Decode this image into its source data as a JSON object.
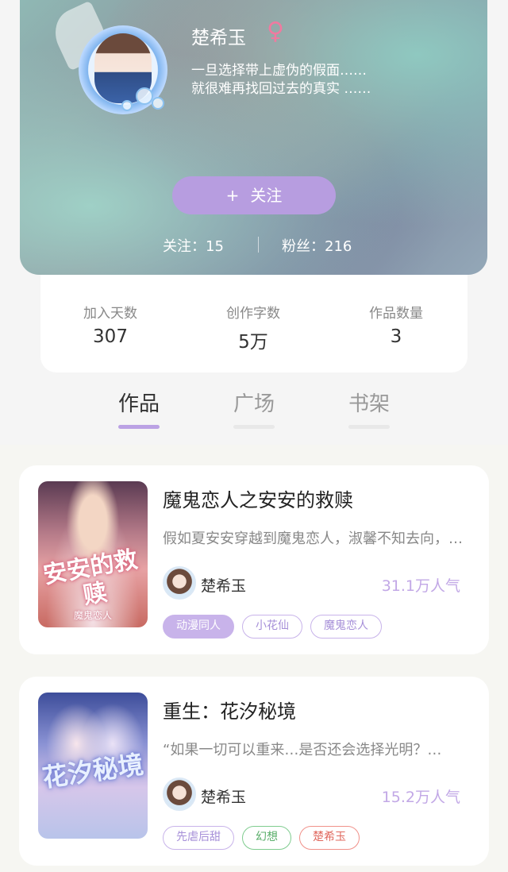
{
  "profile": {
    "name": "楚希玉",
    "gender_symbol": "♀",
    "bio_line1": "一旦选择带上虚伪的假面……",
    "bio_line2": "就很难再找回过去的真实 ……",
    "follow_button": {
      "icon": "+",
      "label": "关注"
    },
    "following": "关注：15",
    "fans": "粉丝：216"
  },
  "info": [
    {
      "label": "加入天数",
      "value": "307"
    },
    {
      "label": "创作字数",
      "value": "5万"
    },
    {
      "label": "作品数量",
      "value": "3"
    }
  ],
  "tabs": [
    {
      "label": "作品",
      "active": true
    },
    {
      "label": "广场",
      "active": false
    },
    {
      "label": "书架",
      "active": false
    }
  ],
  "books": [
    {
      "title": "魔鬼恋人之安安的救赎",
      "description": "假如夏安安穿越到魔鬼恋人，淑馨不知去向，她会遇见什么",
      "author": "楚希玉",
      "popularity": "31.1万人气",
      "cover_title": "安安的救赎",
      "cover_sub": "魔鬼恋人",
      "tags": [
        {
          "label": "动漫同人",
          "style": "filled"
        },
        {
          "label": "小花仙",
          "style": "purple"
        },
        {
          "label": "魔鬼恋人",
          "style": "purple"
        }
      ]
    },
    {
      "title": "重生：花汐秘境",
      "description": "“如果一切可以重来…是否还会选择光明？…",
      "author": "楚希玉",
      "popularity": "15.2万人气",
      "cover_title": "花汐秘境",
      "tags": [
        {
          "label": "先虐后甜",
          "style": "purple"
        },
        {
          "label": "幻想",
          "style": "green"
        },
        {
          "label": "楚希玉",
          "style": "red"
        }
      ]
    }
  ],
  "colors": {
    "accent": "#b79de0",
    "tag_purple": "#c8b3ea",
    "tag_green": "#7fcc8f",
    "tag_red": "#f0918a",
    "popularity": "#c2a8e6",
    "gender": "#f07aa0"
  }
}
